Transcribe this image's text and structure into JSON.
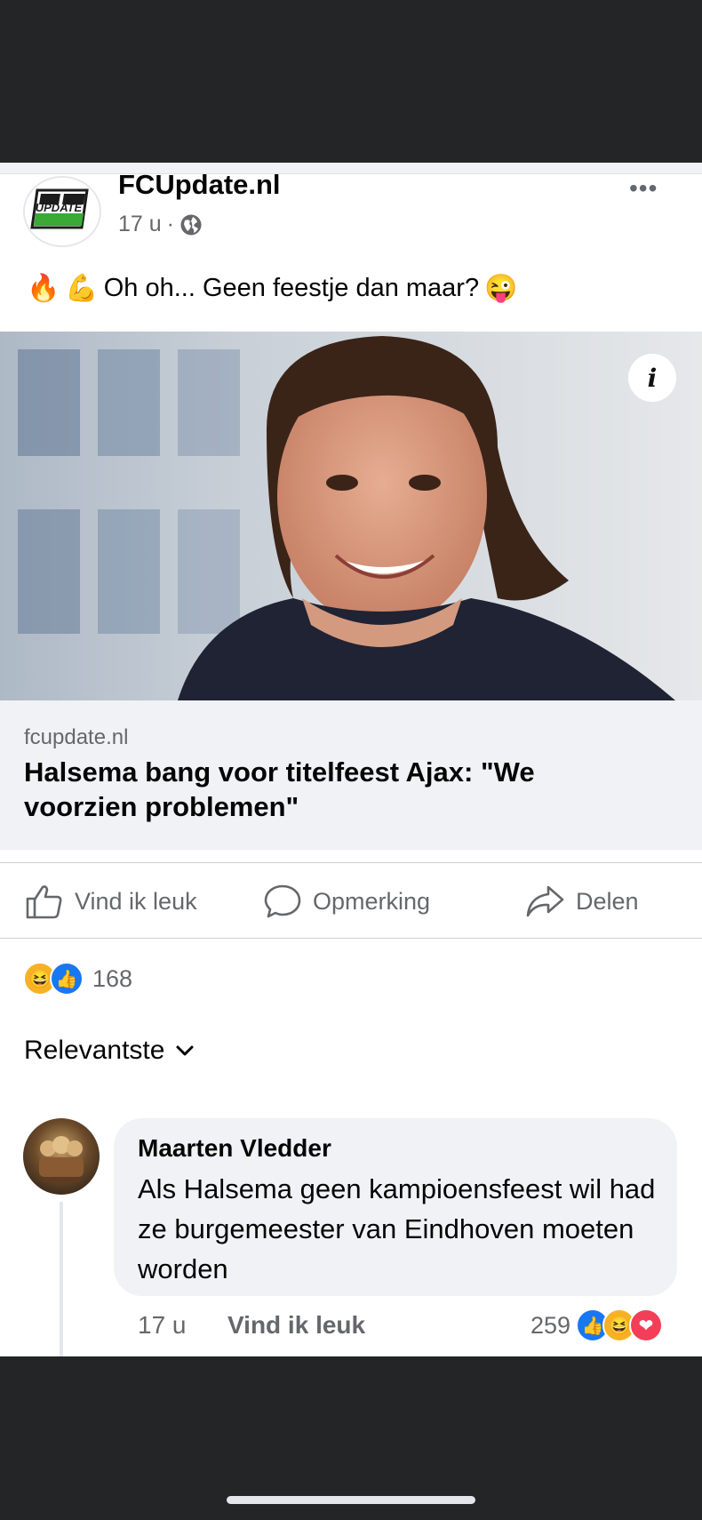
{
  "post": {
    "page_name": "FCUpdate.nl",
    "time": "17 u",
    "separator": "·",
    "more_glyph": "•••",
    "emojis": [
      "🔥",
      "💪",
      "😜"
    ],
    "text": "Oh oh... Geen feestje dan maar?",
    "logo_text_top": "FC",
    "logo_text_bottom": "UPDATE"
  },
  "link": {
    "info_glyph": "i",
    "domain": "fcupdate.nl",
    "title": "Halsema bang voor titelfeest Ajax: \"We voorzien problemen\""
  },
  "actions": {
    "like": "Vind ik leuk",
    "comment": "Opmerking",
    "share": "Delen"
  },
  "reactions": {
    "count": "168",
    "icons": [
      "haha-icon",
      "like-icon"
    ],
    "haha_glyph": "😆",
    "like_glyph": "👍"
  },
  "sort": {
    "label": "Relevantste"
  },
  "comment": {
    "author": "Maarten Vledder",
    "text": "Als Halsema geen kampioensfeest wil had ze burgemeester van Eindhoven moeten worden",
    "time": "17 u",
    "like_label": "Vind ik leuk",
    "reaction_count": "259",
    "reaction_glyphs": [
      "👍",
      "😆",
      "❤"
    ]
  },
  "colors": {
    "facebook_blue": "#1877f2",
    "like_blue": "#1877f2",
    "love_red": "#f33e58",
    "haha_yellow": "#f7b125",
    "logo_green": "#3aa935"
  }
}
